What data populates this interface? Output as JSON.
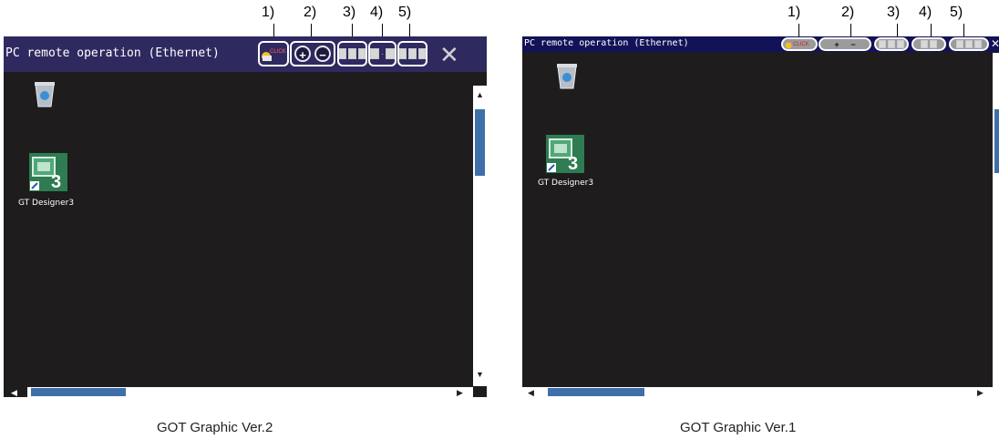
{
  "callouts": [
    "1)",
    "2)",
    "3)",
    "4)",
    "5)"
  ],
  "captions": {
    "ver2": "GOT Graphic Ver.2",
    "ver1": "GOT Graphic Ver.1"
  },
  "window": {
    "title": "PC remote operation (Ethernet)"
  },
  "desktop": {
    "shortcut_label": "GT Designer3"
  },
  "toolbar": {
    "click_text": "CLICK",
    "zoom_in_symbol": "+",
    "zoom_out_symbol": "−",
    "close_symbol": "✕"
  },
  "icons": [
    "click-mode-icon",
    "zoom-in-icon",
    "zoom-out-icon",
    "keyboard-icon",
    "ctrl-esc-icon",
    "ctrl-alt-del-icon",
    "close-icon",
    "recycle-bin-icon",
    "gt-designer3-icon"
  ],
  "colors": {
    "titlebar_v2": "#2e2a60",
    "titlebar_v1": "#121258",
    "desktop": "#1f1c1d",
    "scroll_thumb": "#3f6fa8"
  }
}
